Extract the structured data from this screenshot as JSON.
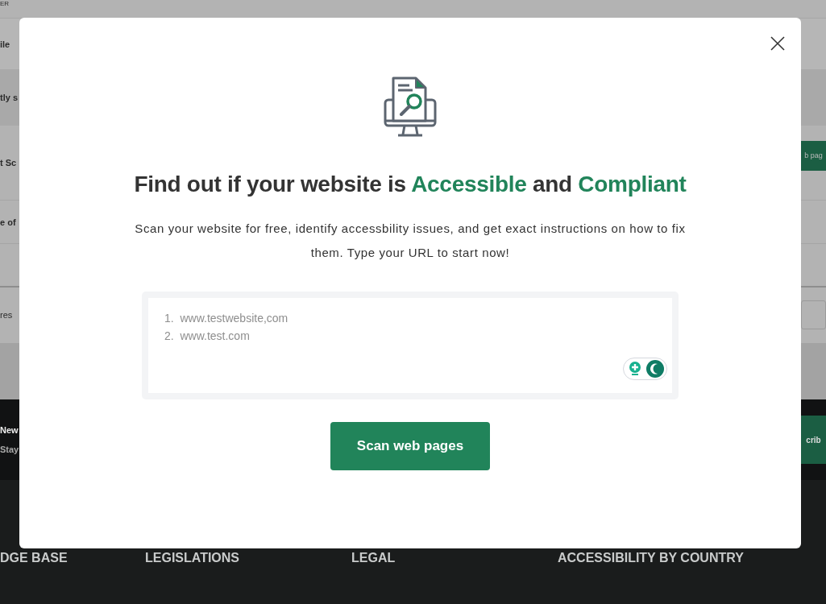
{
  "background_page": {
    "header_fragment": "ER",
    "section_fragments": [
      "ile",
      "tly s"
    ],
    "content": {
      "heading_fragment": "t Sc",
      "button_fragment": "b pag",
      "row_fragment": "e of",
      "input_fragment": "res"
    },
    "newsletter": {
      "title_fragment": "New",
      "text_fragment": "Stay",
      "button_fragment": "crib"
    },
    "footer_headings": [
      "DGE BASE",
      "LEGISLATIONS",
      "LEGAL",
      "ACCESSIBILITY BY COUNTRY"
    ]
  },
  "modal": {
    "heading": [
      {
        "text": "Find out if your website is ",
        "highlight": false
      },
      {
        "text": "Accessible",
        "highlight": true
      },
      {
        "text": " and ",
        "highlight": false
      },
      {
        "text": "Compliant",
        "highlight": true
      }
    ],
    "description": "Scan your website for free, identify accessbility issues, and get exact instructions on how to fix them. Type your URL to start now!",
    "url_field": {
      "placeholder": "1.  www.testwebsite,com\n2.  www.test.com"
    },
    "button": "Scan web pages"
  }
}
